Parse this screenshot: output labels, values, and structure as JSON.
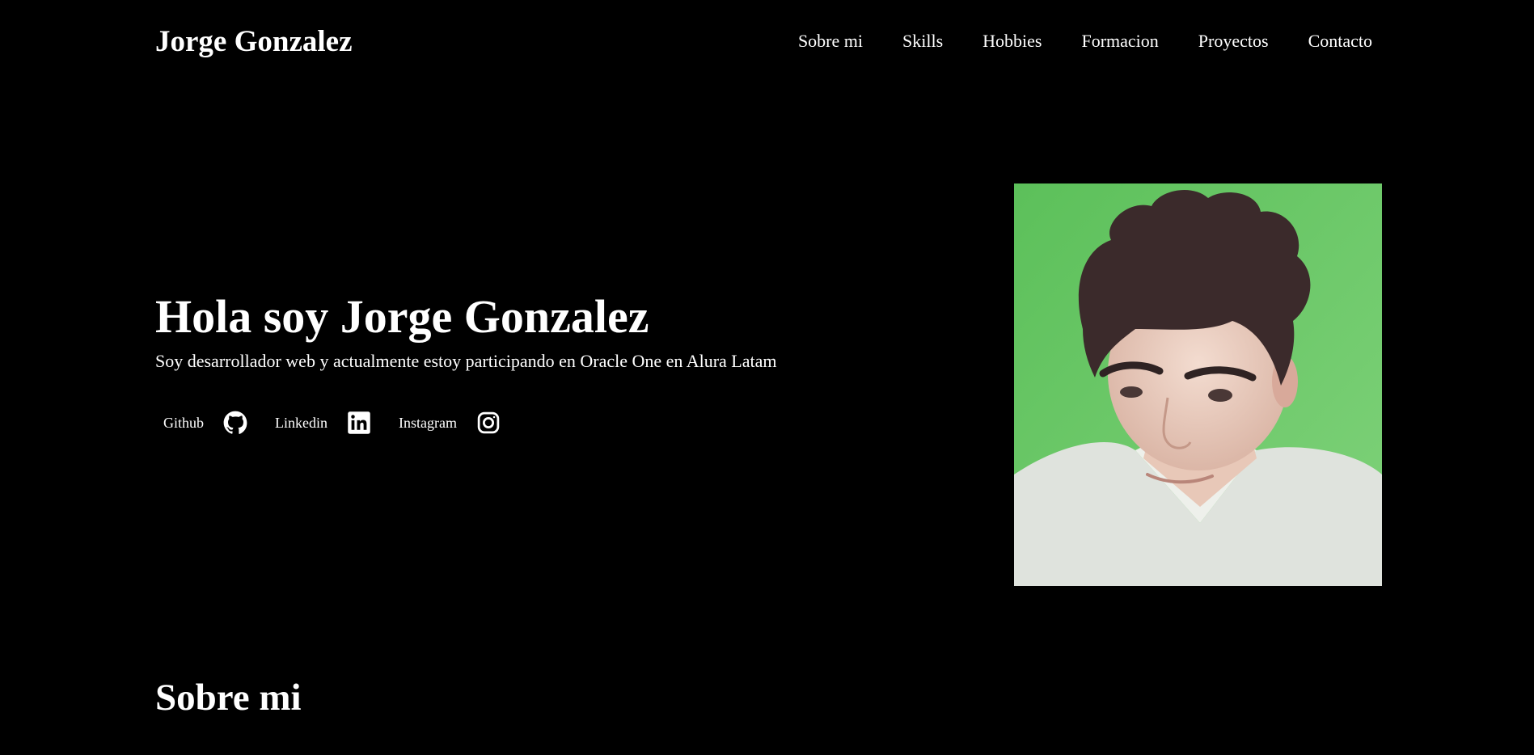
{
  "header": {
    "brand": "Jorge Gonzalez",
    "nav": [
      {
        "label": "Sobre mi"
      },
      {
        "label": "Skills"
      },
      {
        "label": "Hobbies"
      },
      {
        "label": "Formacion"
      },
      {
        "label": "Proyectos"
      },
      {
        "label": "Contacto"
      }
    ]
  },
  "hero": {
    "title": "Hola soy Jorge Gonzalez",
    "subtitle": "Soy desarrollador web y actualmente estoy participando en Oracle One en Alura Latam",
    "socials": [
      {
        "label": "Github",
        "icon": "github-icon"
      },
      {
        "label": "Linkedin",
        "icon": "linkedin-icon"
      },
      {
        "label": "Instagram",
        "icon": "instagram-icon"
      }
    ]
  },
  "about": {
    "title": "Sobre mi"
  },
  "colors": {
    "background": "#000000",
    "text": "#ffffff",
    "photo_background": "#5fc25e"
  }
}
